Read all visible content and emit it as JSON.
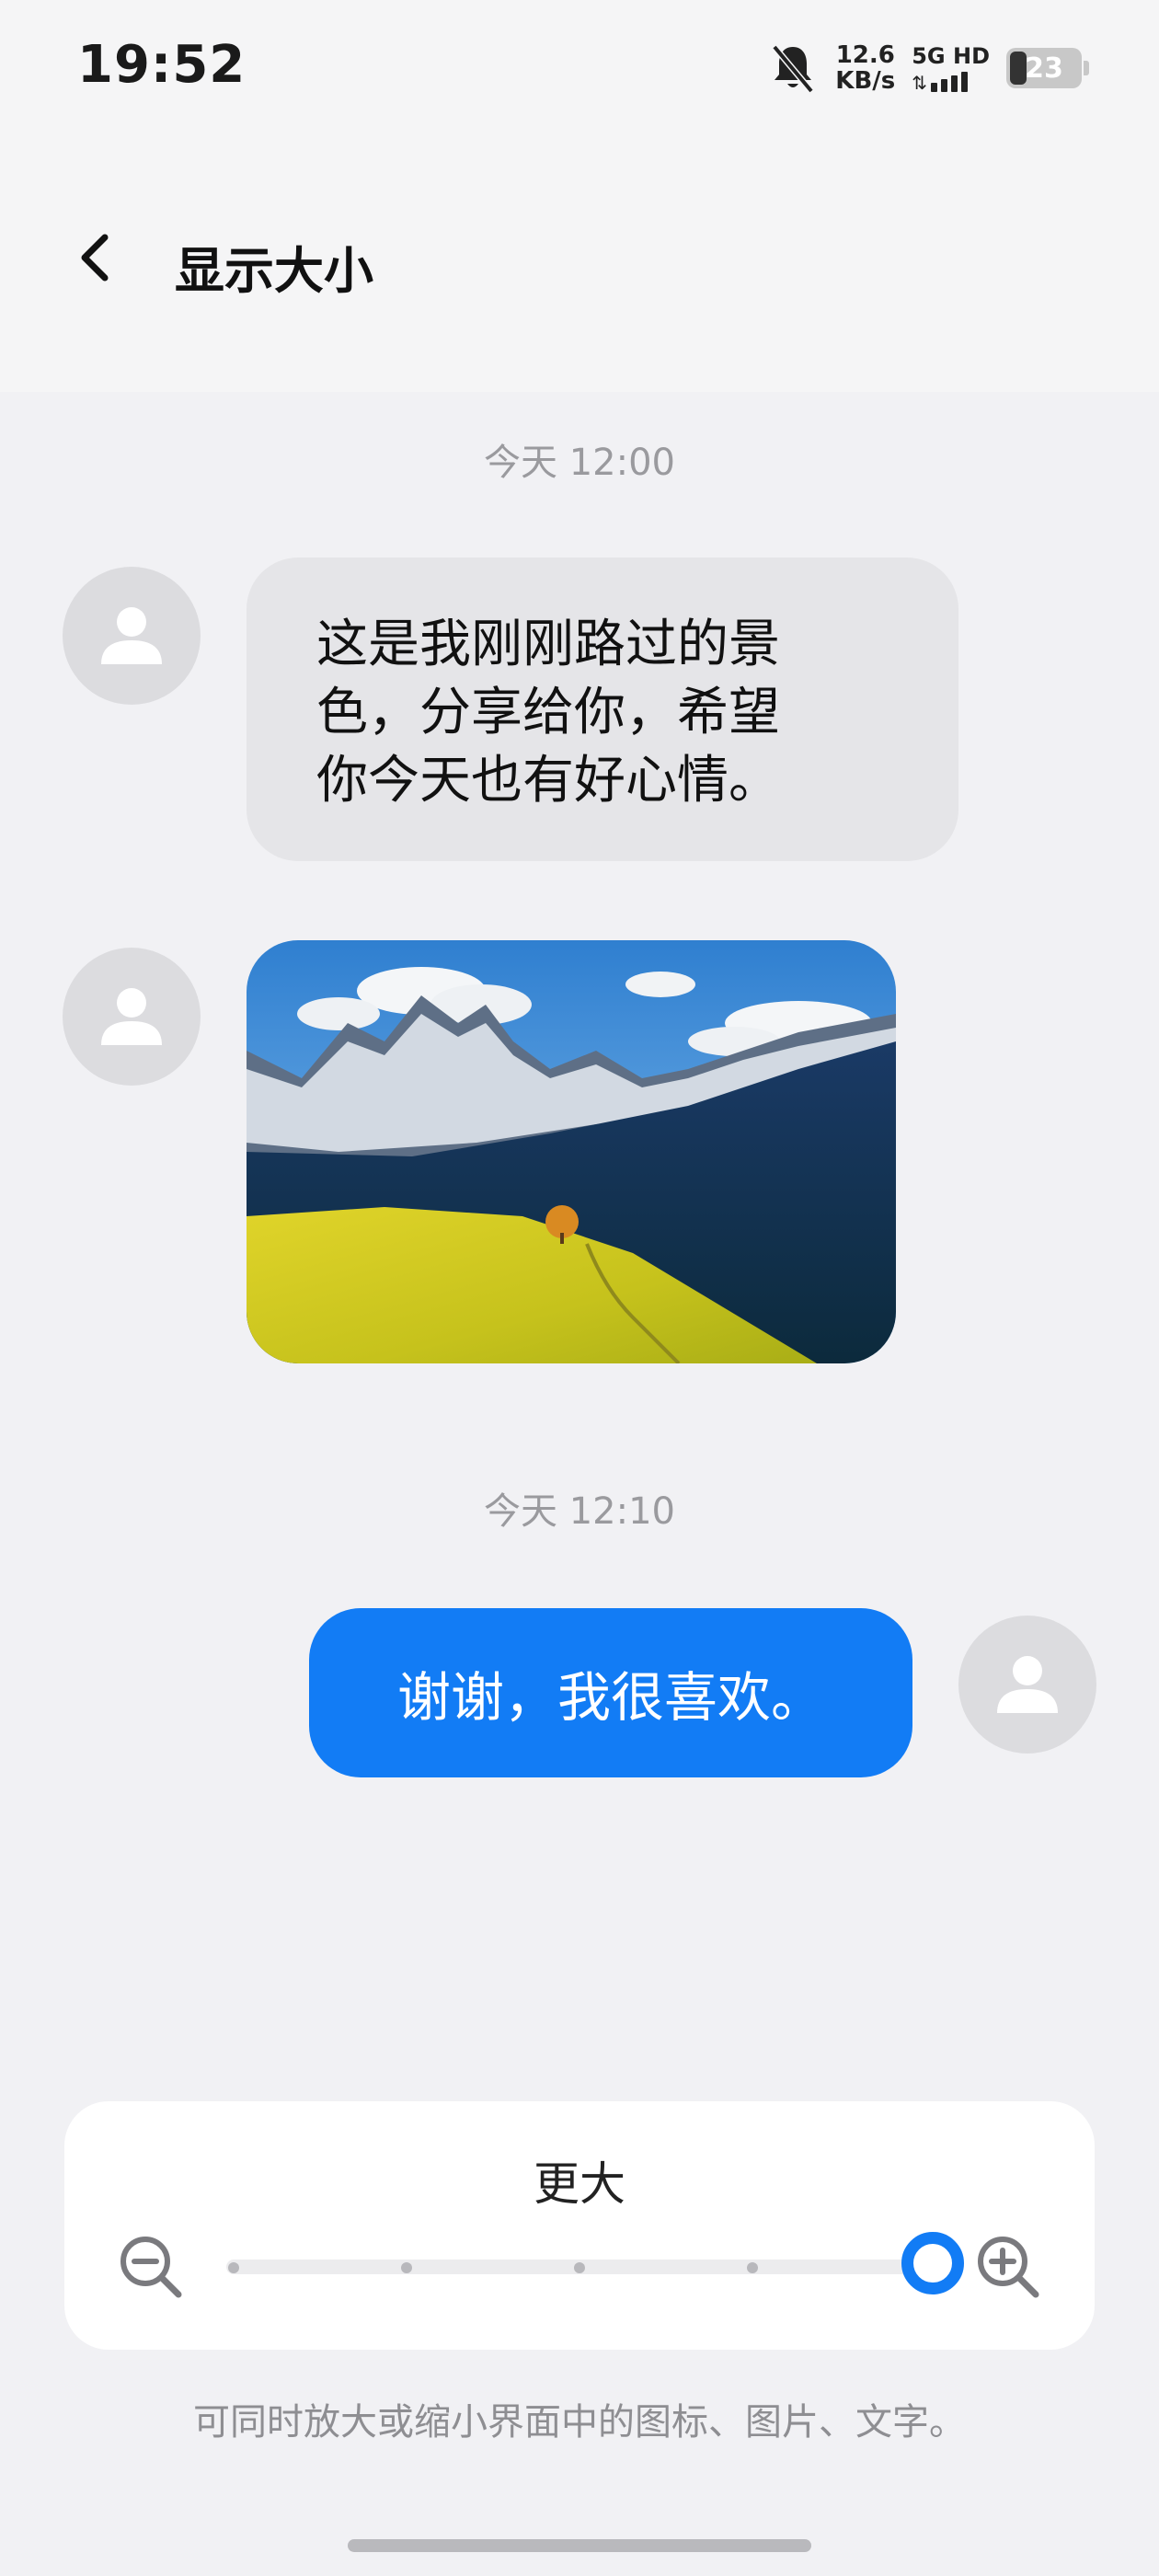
{
  "status_bar": {
    "time": "19:52",
    "net_speed_value": "12.6",
    "net_speed_unit": "KB/s",
    "signal_label": "5G HD",
    "battery_level": "23",
    "icons": [
      "bell-muted-icon",
      "signal-icon",
      "battery-icon"
    ]
  },
  "header": {
    "back_icon": "chevron-left-icon",
    "title": "显示大小"
  },
  "preview": {
    "messages": [
      {
        "timestamp": "今天 12:00"
      },
      {
        "direction": "incoming",
        "lines": [
          "这是我刚刚路过的景",
          "色，分享给你，希望",
          "你今天也有好心情。"
        ]
      },
      {
        "direction": "incoming",
        "type": "image",
        "image_icon": "landscape-photo"
      },
      {
        "timestamp": "今天 12:10"
      },
      {
        "direction": "outgoing",
        "text": "谢谢，我很喜欢。"
      }
    ],
    "avatar_icon": "person-icon"
  },
  "size_control": {
    "label": "更大",
    "zoom_out_icon": "zoom-out-icon",
    "zoom_in_icon": "zoom-in-icon",
    "steps": 6,
    "selected_step": 6
  },
  "hint": "可同时放大或缩小界面中的图标、图片、文字。",
  "colors": {
    "accent": "#127cf5",
    "bubble_incoming": "#e5e5e8",
    "background": "#f1f1f4"
  }
}
